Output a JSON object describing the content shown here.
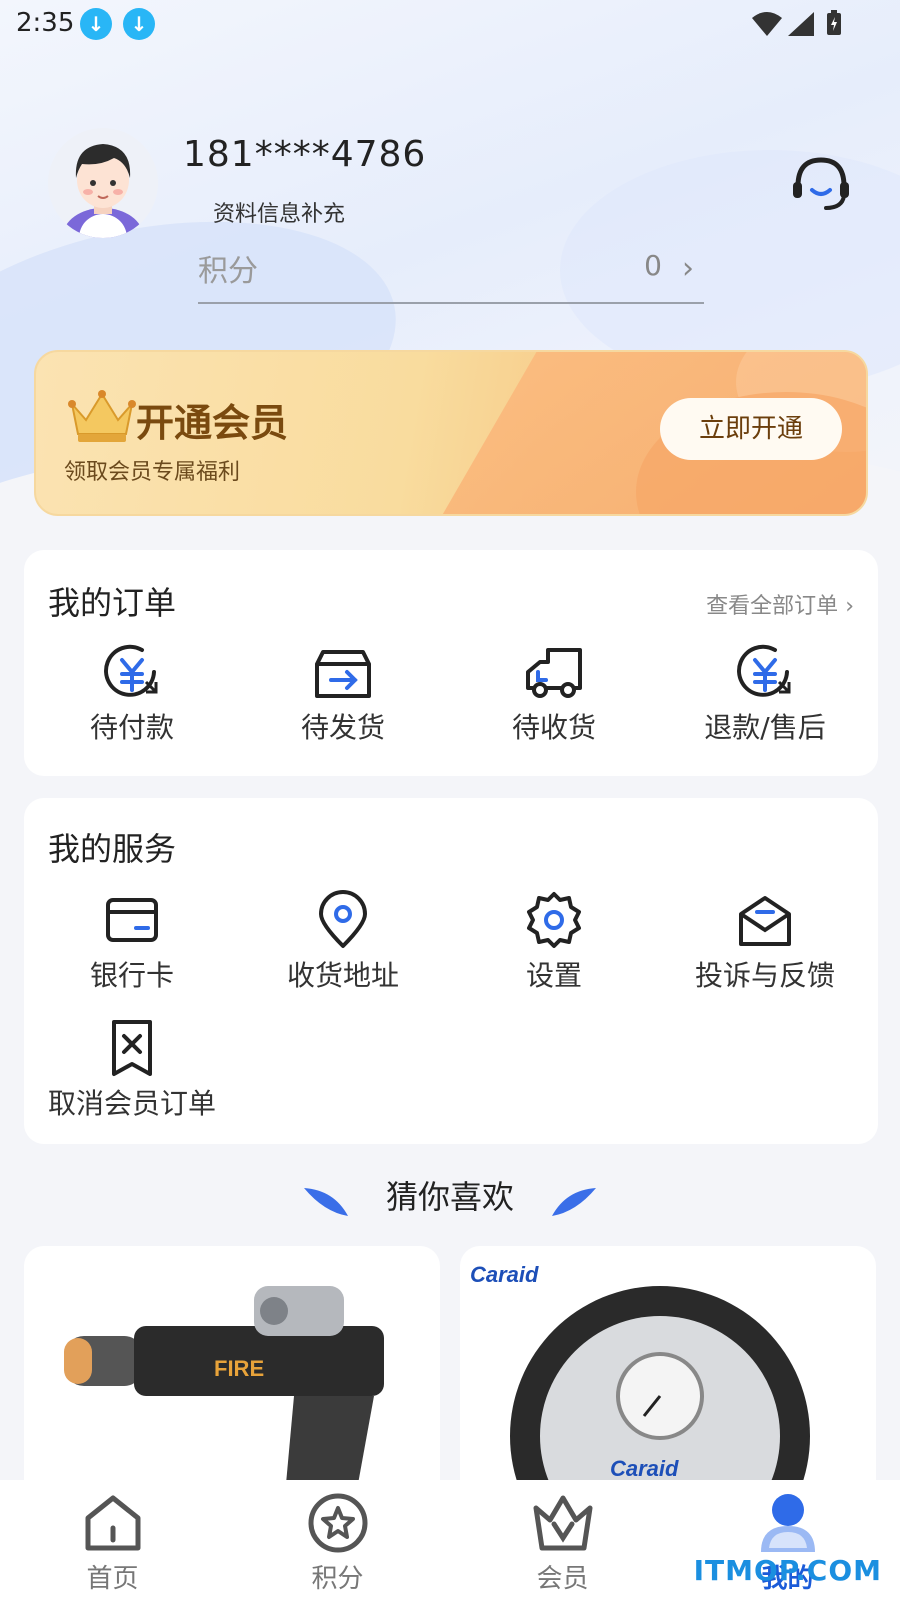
{
  "status_bar": {
    "time": "2:35"
  },
  "profile": {
    "phone": "181****4786",
    "info_link": "资料信息补充",
    "points_label": "积分",
    "points_value": "0"
  },
  "member_banner": {
    "title": "开通会员",
    "subtitle": "领取会员专属福利",
    "button": "立即开通"
  },
  "orders": {
    "title": "我的订单",
    "view_all": "查看全部订单",
    "items": [
      {
        "label": "待付款",
        "icon": "payment-pending-icon"
      },
      {
        "label": "待发货",
        "icon": "to-ship-box-icon"
      },
      {
        "label": "待收货",
        "icon": "truck-icon"
      },
      {
        "label": "退款/售后",
        "icon": "refund-icon"
      }
    ]
  },
  "services": {
    "title": "我的服务",
    "items": [
      {
        "label": "银行卡",
        "icon": "bank-card-icon"
      },
      {
        "label": "收货地址",
        "icon": "location-pin-icon"
      },
      {
        "label": "设置",
        "icon": "gear-icon"
      },
      {
        "label": "投诉与反馈",
        "icon": "envelope-feedback-icon"
      },
      {
        "label": "取消会员订单",
        "icon": "cancel-order-icon"
      }
    ]
  },
  "recommend": {
    "title": "猜你喜欢",
    "products": [
      {
        "name": "toy blaster",
        "image": "toy-gun-product-image",
        "text": "FIRE"
      },
      {
        "name": "tire inflator",
        "image": "tire-inflator-product-image",
        "brand": "Caraid"
      }
    ]
  },
  "tabbar": {
    "items": [
      {
        "label": "首页",
        "icon": "home-icon",
        "active": false
      },
      {
        "label": "积分",
        "icon": "points-star-icon",
        "active": false
      },
      {
        "label": "会员",
        "icon": "vip-crown-icon",
        "active": false
      },
      {
        "label": "我的",
        "icon": "profile-icon",
        "active": true
      }
    ]
  },
  "watermark": "ITMOP.COM",
  "colors": {
    "accent": "#1b5bd8",
    "gold": "#7a4a0f",
    "download_badge": "#29b6f6"
  }
}
